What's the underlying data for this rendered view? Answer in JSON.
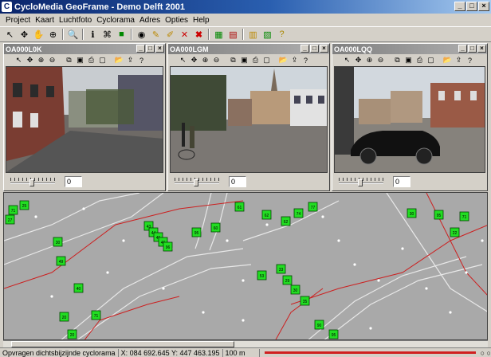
{
  "window": {
    "title": "CycloMedia GeoFrame - Demo Delft 2001"
  },
  "menu": [
    "Project",
    "Kaart",
    "Luchtfoto",
    "Cyclorama",
    "Adres",
    "Opties",
    "Help"
  ],
  "panels": [
    {
      "title": "OA000L0K",
      "zoom": "0"
    },
    {
      "title": "OA000LGM",
      "zoom": "0"
    },
    {
      "title": "OA000LQQ",
      "zoom": "0"
    }
  ],
  "map_markers": [
    "71",
    "25",
    "27",
    "30",
    "49",
    "40",
    "71",
    "20",
    "20",
    "43",
    "44",
    "45",
    "46",
    "96",
    "95",
    "60",
    "61",
    "62",
    "62",
    "74",
    "77",
    "33",
    "53",
    "29",
    "30",
    "35",
    "90",
    "95",
    "30",
    "95",
    "22"
  ],
  "status": {
    "text": "Opvragen dichtsbijzijnde cyclorama",
    "coords": "X: 084 692.645  Y: 447 463.195",
    "scale": "100 m"
  },
  "colors": {
    "marker": "#22dd22",
    "map_bg": "#a9a9a9",
    "road": "#e8e8e8",
    "boundary": "#cc2020"
  }
}
